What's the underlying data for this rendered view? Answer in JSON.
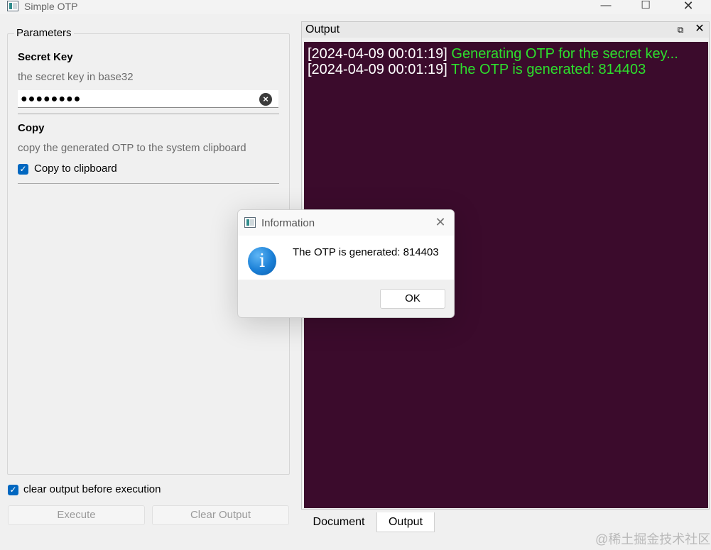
{
  "window": {
    "title": "Simple OTP",
    "min_glyph": "—",
    "max_glyph": "☐",
    "close_glyph": "✕"
  },
  "parameters": {
    "group_title": "Parameters",
    "secret_key": {
      "label": "Secret Key",
      "description": "the secret key in base32",
      "value": "●●●●●●●●",
      "clear_glyph": "×"
    },
    "copy": {
      "label": "Copy",
      "description": "copy the generated OTP to the system clipboard",
      "checkbox_label": "Copy to clipboard",
      "checked": true
    }
  },
  "bottom": {
    "clear_before_label": "clear output before execution",
    "execute_label": "Execute",
    "clear_output_label": "Clear Output"
  },
  "output_dock": {
    "title": "Output",
    "float_glyph": "⧉",
    "close_glyph": "✕",
    "lines": [
      {
        "timestamp": "[2024-04-09 00:01:19]",
        "message": "Generating OTP for the secret key..."
      },
      {
        "timestamp": "[2024-04-09 00:01:19]",
        "message": "The OTP is generated: 814403"
      }
    ],
    "colors": {
      "background": "#3b0b2c",
      "timestamp": "#ffffff",
      "message": "#2de02d"
    }
  },
  "tabs": [
    {
      "label": "Document"
    },
    {
      "label": "Output"
    }
  ],
  "dialog": {
    "title": "Information",
    "close_glyph": "✕",
    "icon_glyph": "i",
    "message": "The OTP is generated: 814403",
    "ok_label": "OK"
  },
  "watermark": "@稀土掘金技术社区",
  "icons": {
    "app": "app-window-icon",
    "info": "info-icon",
    "check": "checkmark-icon"
  },
  "accent_color": "#0067c0"
}
